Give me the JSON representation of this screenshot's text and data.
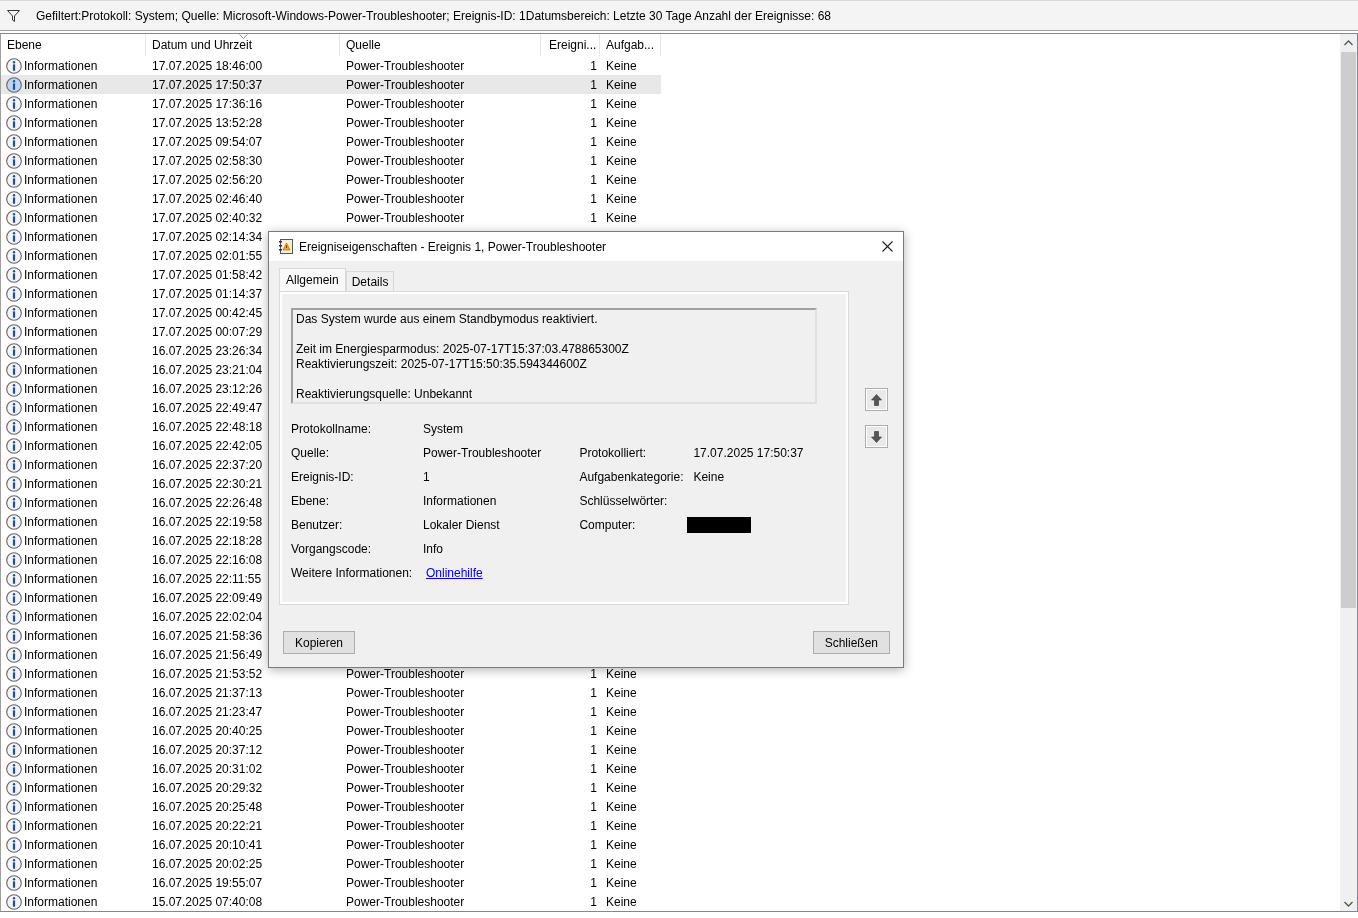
{
  "filter_bar": {
    "text": "Gefiltert:Protokoll: System; Quelle: Microsoft-Windows-Power-Troubleshooter; Ereignis-ID: 1Datumsbereich: Letzte 30 Tage Anzahl der Ereignisse: 68"
  },
  "table": {
    "columns": [
      {
        "label": "Ebene",
        "sorted": false
      },
      {
        "label": "Datum und Uhrzeit",
        "sorted": true
      },
      {
        "label": "Quelle",
        "sorted": false
      },
      {
        "label": "Ereigni...",
        "sorted": false
      },
      {
        "label": "Aufgab...",
        "sorted": false
      }
    ],
    "rows": [
      {
        "level": "Informationen",
        "datetime": "17.07.2025 18:46:00",
        "source": "Power-Troubleshooter",
        "event_id": "1",
        "task": "Keine",
        "selected": false
      },
      {
        "level": "Informationen",
        "datetime": "17.07.2025 17:50:37",
        "source": "Power-Troubleshooter",
        "event_id": "1",
        "task": "Keine",
        "selected": true
      },
      {
        "level": "Informationen",
        "datetime": "17.07.2025 17:36:16",
        "source": "Power-Troubleshooter",
        "event_id": "1",
        "task": "Keine",
        "selected": false
      },
      {
        "level": "Informationen",
        "datetime": "17.07.2025 13:52:28",
        "source": "Power-Troubleshooter",
        "event_id": "1",
        "task": "Keine",
        "selected": false
      },
      {
        "level": "Informationen",
        "datetime": "17.07.2025 09:54:07",
        "source": "Power-Troubleshooter",
        "event_id": "1",
        "task": "Keine",
        "selected": false
      },
      {
        "level": "Informationen",
        "datetime": "17.07.2025 02:58:30",
        "source": "Power-Troubleshooter",
        "event_id": "1",
        "task": "Keine",
        "selected": false
      },
      {
        "level": "Informationen",
        "datetime": "17.07.2025 02:56:20",
        "source": "Power-Troubleshooter",
        "event_id": "1",
        "task": "Keine",
        "selected": false
      },
      {
        "level": "Informationen",
        "datetime": "17.07.2025 02:46:40",
        "source": "Power-Troubleshooter",
        "event_id": "1",
        "task": "Keine",
        "selected": false
      },
      {
        "level": "Informationen",
        "datetime": "17.07.2025 02:40:32",
        "source": "Power-Troubleshooter",
        "event_id": "1",
        "task": "Keine",
        "selected": false
      },
      {
        "level": "Informationen",
        "datetime": "17.07.2025 02:14:34",
        "selected": false
      },
      {
        "level": "Informationen",
        "datetime": "17.07.2025 02:01:55",
        "selected": false
      },
      {
        "level": "Informationen",
        "datetime": "17.07.2025 01:58:42",
        "selected": false
      },
      {
        "level": "Informationen",
        "datetime": "17.07.2025 01:14:37",
        "selected": false
      },
      {
        "level": "Informationen",
        "datetime": "17.07.2025 00:42:45",
        "selected": false
      },
      {
        "level": "Informationen",
        "datetime": "17.07.2025 00:07:29",
        "selected": false
      },
      {
        "level": "Informationen",
        "datetime": "16.07.2025 23:26:34",
        "selected": false
      },
      {
        "level": "Informationen",
        "datetime": "16.07.2025 23:21:04",
        "selected": false
      },
      {
        "level": "Informationen",
        "datetime": "16.07.2025 23:12:26",
        "selected": false
      },
      {
        "level": "Informationen",
        "datetime": "16.07.2025 22:49:47",
        "selected": false
      },
      {
        "level": "Informationen",
        "datetime": "16.07.2025 22:48:18",
        "selected": false
      },
      {
        "level": "Informationen",
        "datetime": "16.07.2025 22:42:05",
        "selected": false
      },
      {
        "level": "Informationen",
        "datetime": "16.07.2025 22:37:20",
        "selected": false
      },
      {
        "level": "Informationen",
        "datetime": "16.07.2025 22:30:21",
        "selected": false
      },
      {
        "level": "Informationen",
        "datetime": "16.07.2025 22:26:48",
        "selected": false
      },
      {
        "level": "Informationen",
        "datetime": "16.07.2025 22:19:58",
        "selected": false
      },
      {
        "level": "Informationen",
        "datetime": "16.07.2025 22:18:28",
        "selected": false
      },
      {
        "level": "Informationen",
        "datetime": "16.07.2025 22:16:08",
        "selected": false
      },
      {
        "level": "Informationen",
        "datetime": "16.07.2025 22:11:55",
        "selected": false
      },
      {
        "level": "Informationen",
        "datetime": "16.07.2025 22:09:49",
        "selected": false
      },
      {
        "level": "Informationen",
        "datetime": "16.07.2025 22:02:04",
        "selected": false
      },
      {
        "level": "Informationen",
        "datetime": "16.07.2025 21:58:36",
        "selected": false
      },
      {
        "level": "Informationen",
        "datetime": "16.07.2025 21:56:49",
        "selected": false
      },
      {
        "level": "Informationen",
        "datetime": "16.07.2025 21:53:52",
        "source": "Power-Troubleshooter",
        "event_id": "1",
        "task": "Keine",
        "selected": false
      },
      {
        "level": "Informationen",
        "datetime": "16.07.2025 21:37:13",
        "source": "Power-Troubleshooter",
        "event_id": "1",
        "task": "Keine",
        "selected": false
      },
      {
        "level": "Informationen",
        "datetime": "16.07.2025 21:23:47",
        "source": "Power-Troubleshooter",
        "event_id": "1",
        "task": "Keine",
        "selected": false
      },
      {
        "level": "Informationen",
        "datetime": "16.07.2025 20:40:25",
        "source": "Power-Troubleshooter",
        "event_id": "1",
        "task": "Keine",
        "selected": false
      },
      {
        "level": "Informationen",
        "datetime": "16.07.2025 20:37:12",
        "source": "Power-Troubleshooter",
        "event_id": "1",
        "task": "Keine",
        "selected": false
      },
      {
        "level": "Informationen",
        "datetime": "16.07.2025 20:31:02",
        "source": "Power-Troubleshooter",
        "event_id": "1",
        "task": "Keine",
        "selected": false
      },
      {
        "level": "Informationen",
        "datetime": "16.07.2025 20:29:32",
        "source": "Power-Troubleshooter",
        "event_id": "1",
        "task": "Keine",
        "selected": false
      },
      {
        "level": "Informationen",
        "datetime": "16.07.2025 20:25:48",
        "source": "Power-Troubleshooter",
        "event_id": "1",
        "task": "Keine",
        "selected": false
      },
      {
        "level": "Informationen",
        "datetime": "16.07.2025 20:22:21",
        "source": "Power-Troubleshooter",
        "event_id": "1",
        "task": "Keine",
        "selected": false
      },
      {
        "level": "Informationen",
        "datetime": "16.07.2025 20:10:41",
        "source": "Power-Troubleshooter",
        "event_id": "1",
        "task": "Keine",
        "selected": false
      },
      {
        "level": "Informationen",
        "datetime": "16.07.2025 20:02:25",
        "source": "Power-Troubleshooter",
        "event_id": "1",
        "task": "Keine",
        "selected": false
      },
      {
        "level": "Informationen",
        "datetime": "16.07.2025 19:55:07",
        "source": "Power-Troubleshooter",
        "event_id": "1",
        "task": "Keine",
        "selected": false
      },
      {
        "level": "Informationen",
        "datetime": "15.07.2025 07:40:08",
        "source": "Power-Troubleshooter",
        "event_id": "1",
        "task": "Keine",
        "selected": false
      }
    ]
  },
  "dialog": {
    "title": "Ereigniseigenschaften - Ereignis 1, Power-Troubleshooter",
    "tabs": [
      {
        "label": "Allgemein",
        "selected": true
      },
      {
        "label": "Details",
        "selected": false
      }
    ],
    "message": [
      [
        "Das System wurde aus einem Standbymodus reaktiviert."
      ],
      [
        "Zeit im Energiesparmodus: 2025-07-17T15:37:03.478865300Z",
        "Reaktivierungszeit: 2025-07-17T15:50:35.594344600Z"
      ],
      [
        "Reaktivierungsquelle: Unbekannt"
      ]
    ],
    "details": [
      {
        "cells": [
          {
            "label": "Protokollname:",
            "value": "System",
            "kind": "text"
          }
        ]
      },
      {
        "cells": [
          {
            "label": "Quelle:",
            "value": "Power-Troubleshooter",
            "kind": "text"
          },
          {
            "label": "Protokolliert:",
            "value": "17.07.2025 17:50:37",
            "kind": "text"
          }
        ]
      },
      {
        "cells": [
          {
            "label": "Ereignis-ID:",
            "value": "1",
            "kind": "text"
          },
          {
            "label": "Aufgabenkategorie:",
            "value": "Keine",
            "kind": "text"
          }
        ]
      },
      {
        "cells": [
          {
            "label": "Ebene:",
            "value": "Informationen",
            "kind": "text"
          },
          {
            "label": "Schlüsselwörter:",
            "kind": "text"
          }
        ]
      },
      {
        "cells": [
          {
            "label": "Benutzer:",
            "value": "Lokaler Dienst",
            "kind": "text"
          },
          {
            "label": "Computer:",
            "kind": "redacted"
          }
        ]
      },
      {
        "cells": [
          {
            "label": "Vorgangscode:",
            "value": "Info",
            "kind": "text"
          }
        ]
      },
      {
        "cells": [
          {
            "label": "Weitere Informationen:",
            "value": "Onlinehilfe",
            "kind": "link"
          }
        ]
      }
    ],
    "buttons": [
      "Kopieren",
      "Schließen"
    ]
  }
}
